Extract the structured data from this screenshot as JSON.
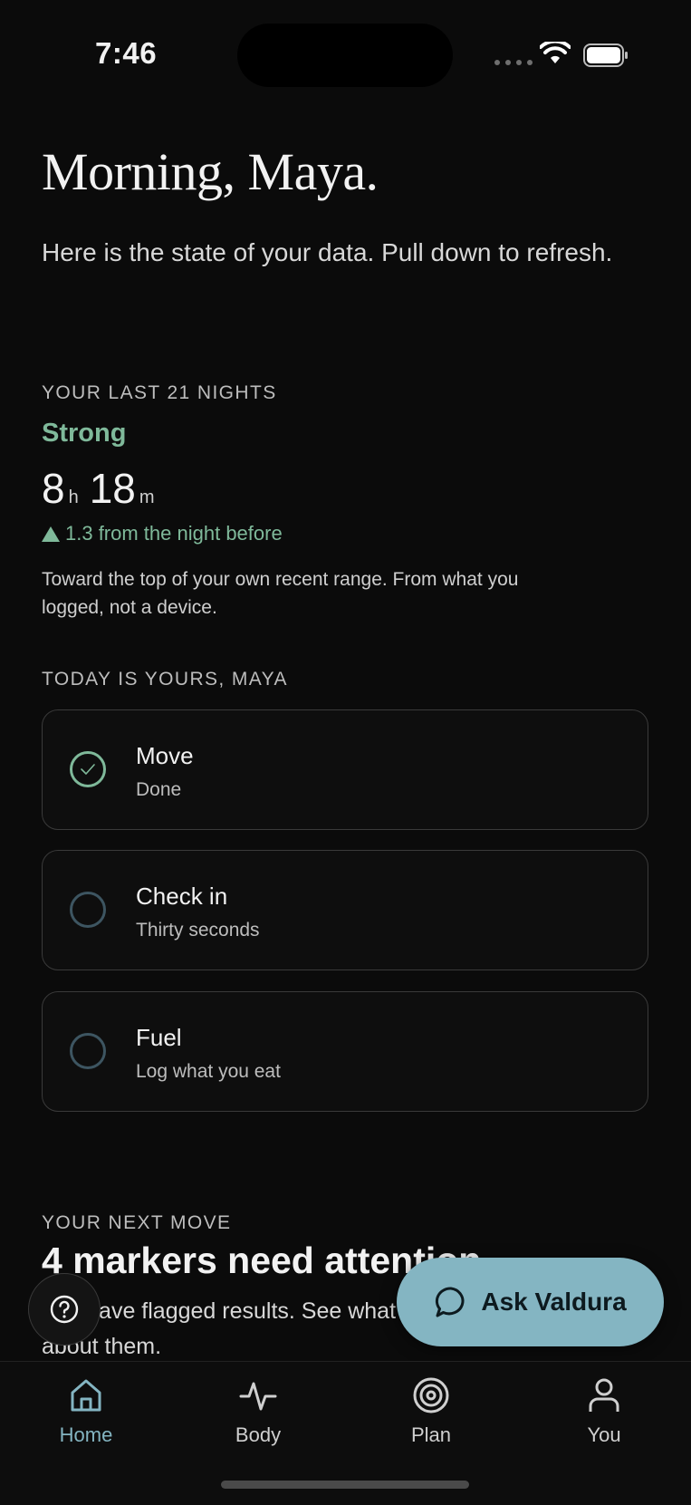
{
  "status_bar": {
    "time": "7:46"
  },
  "header": {
    "greeting": "Morning, Maya.",
    "subtitle": "Here is the state of your data. Pull down to refresh."
  },
  "sleep": {
    "section_label": "YOUR LAST 21 NIGHTS",
    "rating": "Strong",
    "hours": "8",
    "hours_unit": "h",
    "minutes": "18",
    "minutes_unit": "m",
    "delta": "1.3 from the night before",
    "note": "Toward the top of your own recent range. From what you logged, not a device."
  },
  "today": {
    "section_label": "TODAY IS YOURS, MAYA",
    "tasks": [
      {
        "title": "Move",
        "subtitle": "Done",
        "done": true
      },
      {
        "title": "Check in",
        "subtitle": "Thirty seconds",
        "done": false
      },
      {
        "title": "Fuel",
        "subtitle": "Log what you eat",
        "done": false
      }
    ]
  },
  "next_move": {
    "section_label": "YOUR NEXT MOVE",
    "title": "4 markers need attention",
    "description": "You have flagged results. See what to do about them."
  },
  "fab": {
    "label": "Ask Valdura",
    "icon": "chat-bubble-icon"
  },
  "help": {
    "icon": "question-circle-icon"
  },
  "tabs": [
    {
      "label": "Home",
      "icon": "home-icon",
      "active": true
    },
    {
      "label": "Body",
      "icon": "pulse-icon",
      "active": false
    },
    {
      "label": "Plan",
      "icon": "target-icon",
      "active": false
    },
    {
      "label": "You",
      "icon": "person-icon",
      "active": false
    }
  ],
  "colors": {
    "background": "#0b0b0b",
    "accent_green": "#7fb99a",
    "accent_blue": "#84b5c2",
    "pending_ring": "#3d5561"
  }
}
